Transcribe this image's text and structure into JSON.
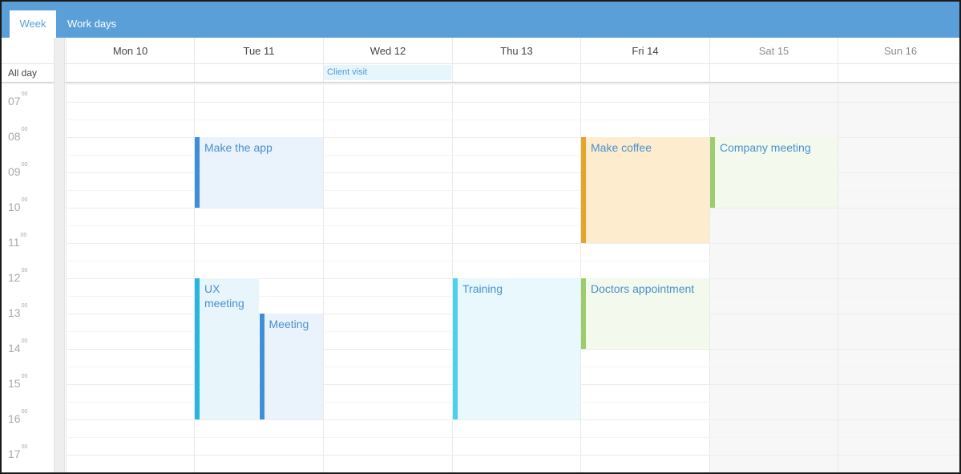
{
  "toolbar": {
    "tabs": [
      {
        "label": "Week"
      },
      {
        "label": "Work days"
      }
    ]
  },
  "header": {
    "days": [
      {
        "label": "Mon 10",
        "weekend": false
      },
      {
        "label": "Tue 11",
        "weekend": false
      },
      {
        "label": "Wed 12",
        "weekend": false
      },
      {
        "label": "Thu 13",
        "weekend": false
      },
      {
        "label": "Fri 14",
        "weekend": false
      },
      {
        "label": "Sat 15",
        "weekend": true
      },
      {
        "label": "Sun 16",
        "weekend": true
      }
    ]
  },
  "allday": {
    "label": "All day",
    "events": [
      {
        "title": "Client visit",
        "day": 2
      }
    ]
  },
  "grid": {
    "start_hour": 6.5,
    "hours": [
      {
        "h": "07",
        "m": "00"
      },
      {
        "h": "08",
        "m": "00"
      },
      {
        "h": "09",
        "m": "00"
      },
      {
        "h": "10",
        "m": "00"
      },
      {
        "h": "11",
        "m": "00"
      },
      {
        "h": "12",
        "m": "00"
      },
      {
        "h": "13",
        "m": "00"
      },
      {
        "h": "14",
        "m": "00"
      },
      {
        "h": "15",
        "m": "00"
      },
      {
        "h": "16",
        "m": "00"
      },
      {
        "h": "17",
        "m": "00"
      }
    ]
  },
  "events": [
    {
      "title": "Make the app",
      "day": 1,
      "start": 8.0,
      "end": 10.0,
      "lane": 0,
      "lanes": 1,
      "bar": "#3f8ed8",
      "bg": "#eaf3fb",
      "text": "#4a8fd0"
    },
    {
      "title": "UX meeting",
      "day": 1,
      "start": 12.0,
      "end": 16.0,
      "lane": 0,
      "lanes": 2,
      "bar": "#27b7de",
      "bg": "#e8f6fc",
      "text": "#4a8fd0"
    },
    {
      "title": "Meeting",
      "day": 1,
      "start": 13.0,
      "end": 16.0,
      "lane": 1,
      "lanes": 2,
      "bar": "#3f8ed8",
      "bg": "#eaf3fb",
      "text": "#4a8fd0"
    },
    {
      "title": "Training",
      "day": 3,
      "start": 12.0,
      "end": 16.0,
      "lane": 0,
      "lanes": 1,
      "bar": "#4cd0f0",
      "bg": "#e9f8fd",
      "text": "#4a8fd0"
    },
    {
      "title": "Make coffee",
      "day": 4,
      "start": 8.0,
      "end": 11.0,
      "lane": 0,
      "lanes": 1,
      "bar": "#e5a52a",
      "bg": "#fdedce",
      "text": "#4a8fd0"
    },
    {
      "title": "Doctors appointment",
      "day": 4,
      "start": 12.0,
      "end": 14.0,
      "lane": 0,
      "lanes": 1,
      "bar": "#9ccc6c",
      "bg": "#f3f9ec",
      "text": "#4a8fd0"
    },
    {
      "title": "Company meeting",
      "day": 5,
      "start": 8.0,
      "end": 10.0,
      "lane": 0,
      "lanes": 1,
      "bar": "#9ccc6c",
      "bg": "#f3f9ec",
      "text": "#4a8fd0"
    }
  ]
}
